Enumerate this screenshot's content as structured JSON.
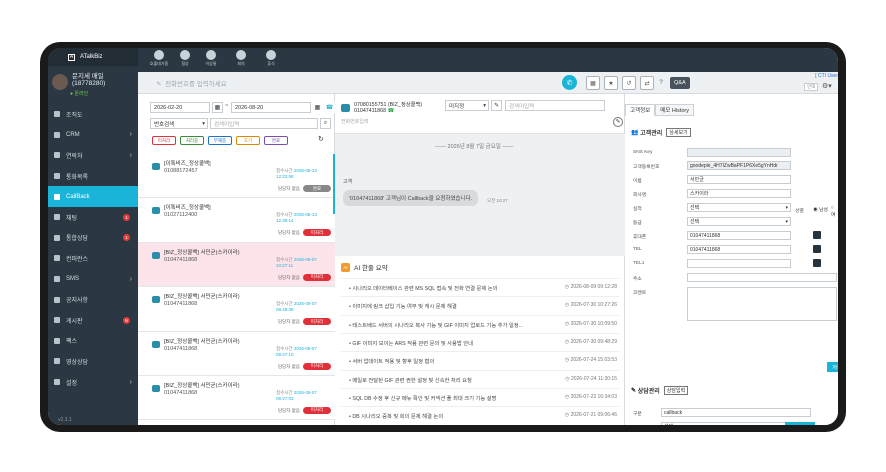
{
  "app": {
    "title": "ATalkBiz",
    "version": "v2.3.1"
  },
  "user": {
    "name": "문지세 매일",
    "id": "(18778280)",
    "status": "온라인"
  },
  "sidebar": {
    "items": [
      {
        "label": "조직도",
        "chev": "",
        "badge": ""
      },
      {
        "label": "CRM",
        "chev": "›",
        "badge": ""
      },
      {
        "label": "연락처",
        "chev": "›",
        "badge": ""
      },
      {
        "label": "통화목록",
        "chev": "",
        "badge": ""
      },
      {
        "label": "CallBack",
        "chev": "",
        "badge": ""
      },
      {
        "label": "채팅",
        "chev": "",
        "badge": "1"
      },
      {
        "label": "통합상담",
        "chev": "",
        "badge": "1"
      },
      {
        "label": "컨퍼런스",
        "chev": "",
        "badge": ""
      },
      {
        "label": "SMS",
        "chev": "›",
        "badge": ""
      },
      {
        "label": "공지사항",
        "chev": "",
        "badge": ""
      },
      {
        "label": "게시판",
        "chev": "",
        "badge": "N"
      },
      {
        "label": "팩스",
        "chev": "",
        "badge": ""
      },
      {
        "label": "영상상담",
        "chev": "",
        "badge": ""
      },
      {
        "label": "설정",
        "chev": "›",
        "badge": ""
      }
    ]
  },
  "toolbar": {
    "items": [
      "호출대기중",
      "협상",
      "이상통",
      "회의",
      "휴식"
    ]
  },
  "topbar": {
    "call_placeholder": "전화번호를 입력하세요",
    "qna": "Q&A",
    "cti_user": "[ CTI User",
    "view_label": "인덱"
  },
  "list": {
    "date_from": "2026-02-20",
    "date_to": "2026-08-20",
    "search_type": "번호검색",
    "search_placeholder": "검색어입력",
    "filters": [
      "미처리",
      "처리중",
      "부재중",
      "호기",
      "완료"
    ],
    "items": [
      {
        "title": "[이톡비즈_정상콜백]",
        "phone": "01088172457",
        "time_label": "접수시간",
        "time": "2026-08-13 12:22:58",
        "agent": "담당자 없음",
        "status": "완료",
        "done": true
      },
      {
        "title": "[이톡비즈_정상콜백]",
        "phone": "01027112400",
        "time_label": "접수시간",
        "time": "2026-08-13 12:39:14",
        "agent": "담당자 없음",
        "status": "미처리",
        "done": false
      },
      {
        "title": "[BIZ_정상콜백] 서민균(스카이라)",
        "phone": "01047411868",
        "time_label": "접수시간",
        "time": "2026-08-07 10:27:11",
        "agent": "담당자 없음",
        "status": "미처리",
        "done": false
      },
      {
        "title": "[BIZ_정상콜백] 서민균(스카이라)",
        "phone": "01047411868",
        "time_label": "접수시간",
        "time": "2026-08-07 09:48:36",
        "agent": "담당자 없음",
        "status": "미처리",
        "done": false
      },
      {
        "title": "[BIZ_정상콜백] 서민균(스카이라)",
        "phone": "01047411868",
        "time_label": "접수시간",
        "time": "2026-08-07 09:47:10",
        "agent": "담당자 없음",
        "status": "미처리",
        "done": false
      },
      {
        "title": "[BIZ_정상콜백] 서민균(스카이라)",
        "phone": "01047411868",
        "time_label": "접수시간",
        "time": "2026-08-07 09:27:03",
        "agent": "담당자 없음",
        "status": "미처리",
        "done": false
      }
    ]
  },
  "chat": {
    "header_line1": "07080155751 (BIZ_정상콜백)",
    "header_line2": "01047411868",
    "agent_select": "미지정",
    "search_placeholder": "검색어입력",
    "memo_placeholder": "전화번호입력",
    "date_bar": "—— 2026년 8월 7일 금요일 ——",
    "msg_from": "고객",
    "msg_text": "'01047411868' 고객님이 Callback을 요청하였습니다.",
    "msg_time": "오전 10:27"
  },
  "summary": {
    "title": "AI 한줄 요약",
    "rows": [
      {
        "text": "시나리오 데이터베이스 관련 MS SQL 접속 및 전화 연결 문제 논의",
        "date": "2026-08-09 09:12:28"
      },
      {
        "text": "이미지에 링크 삽입 기능 여부 및 캐시 문제 해결",
        "date": "2026-07-30 10:27:26"
      },
      {
        "text": "테스트베드 서버의 시나리오 복사 기능 및 GIF 이미지 업로드 기능 추가 일정...",
        "date": "2026-07-30 10:09:50"
      },
      {
        "text": "GIF 이미지 보이는 ARS 적용 관련 문의 및 사용법 안내",
        "date": "2026-07-30 09:48:29"
      },
      {
        "text": "서버 업데이트 적용 및 향후 일정 협의",
        "date": "2026-07-24 15:03:53"
      },
      {
        "text": "메일로 전달된 GIF 관련 권한 설정 및 신속한 처리 요청",
        "date": "2026-07-24 11:30:15"
      },
      {
        "text": "SQL DB 수정 후 신규 메뉴 확인 및 커넥션 풀 최대 크기 기능 설명",
        "date": "2026-07-22 16:34:03"
      },
      {
        "text": "DB 시나리오 중복 및 회의 문제 해결 논의",
        "date": "2026-07-21 09:06:46"
      }
    ]
  },
  "customer": {
    "tabs": [
      "고객정보",
      "메모 History"
    ],
    "section_title": "고객관리",
    "detail_btn": "상세보기",
    "fields": [
      {
        "label": "SNS Key",
        "value": ""
      },
      {
        "label": "고객등록번호",
        "value": "goodeple_4H7IZwBaPF1P6Xe5gYnHdr"
      },
      {
        "label": "이름",
        "value": "서민균"
      },
      {
        "label": "회사명",
        "value": "스카이라"
      },
      {
        "label": "실적",
        "value": "선택"
      },
      {
        "label": "등급",
        "value": "선택"
      },
      {
        "label": "휴대폰",
        "value": "01047411868"
      },
      {
        "label": "TEL",
        "value": "01047411868"
      },
      {
        "label": "TEL1",
        "value": ""
      },
      {
        "label": "주소",
        "value": ""
      },
      {
        "label": "코멘트",
        "value": ""
      }
    ],
    "gender_label": "성별",
    "gender_options": [
      "남성",
      "여"
    ],
    "save": "저장"
  },
  "consult": {
    "section_title": "상담관리",
    "input_btn": "상담입력",
    "fields": [
      {
        "label": "구분",
        "value": "callback"
      },
      {
        "label": "유형",
        "value": "선택"
      },
      {
        "label": "상담내용",
        "value": ""
      }
    ]
  }
}
